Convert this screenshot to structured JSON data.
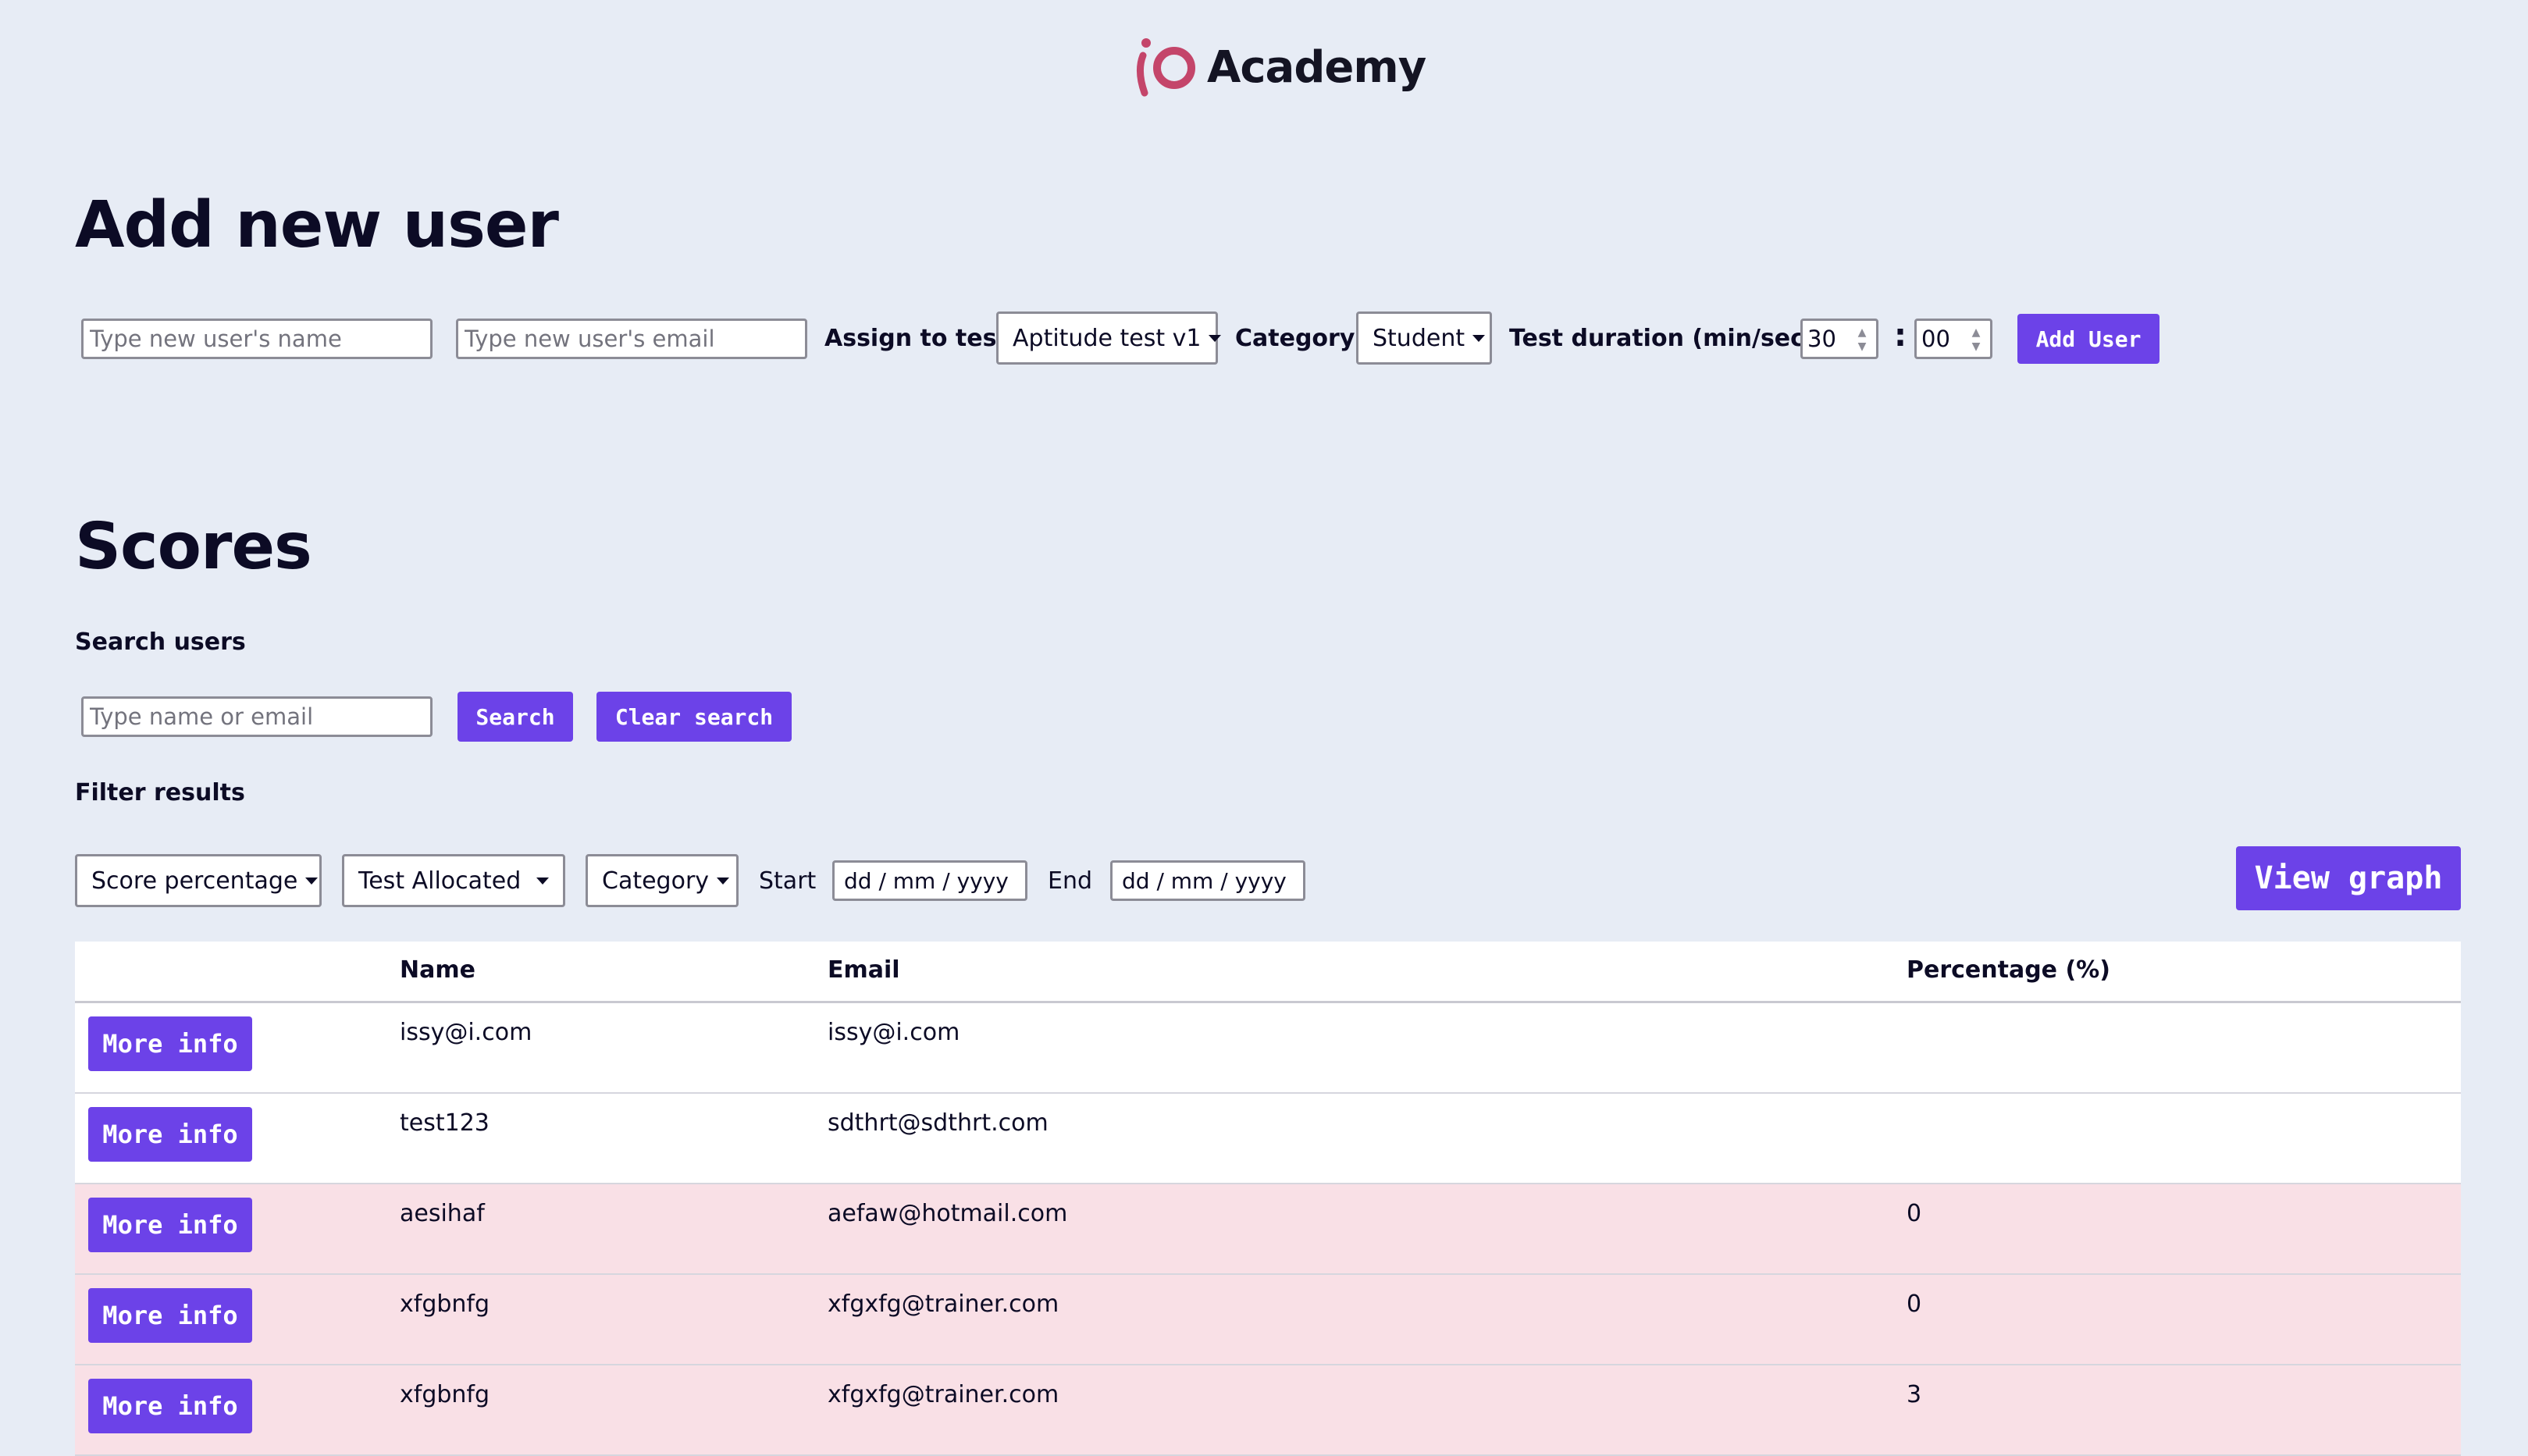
{
  "brand": {
    "name": "Academy",
    "logo_color": "#c4456a"
  },
  "add_user": {
    "title": "Add new user",
    "name_placeholder": "Type new user's name",
    "email_placeholder": "Type new user's email",
    "assign_label": "Assign to test:",
    "test_selected": "Aptitude test v1",
    "category_label": "Category:",
    "category_selected": "Student",
    "duration_label": "Test duration (min/sec) :",
    "minutes": "30",
    "seconds": "00",
    "colon": ":",
    "submit_label": "Add User"
  },
  "scores": {
    "title": "Scores",
    "search_label": "Search users",
    "search_placeholder": "Type name or email",
    "search_button": "Search",
    "clear_button": "Clear search",
    "filter_label": "Filter results",
    "filters": {
      "score": "Score percentage",
      "test": "Test Allocated",
      "category": "Category",
      "start_label": "Start",
      "start_value": "dd / mm / yyyy",
      "end_label": "End",
      "end_value": "dd / mm / yyyy"
    },
    "view_graph_button": "View graph",
    "table": {
      "columns": [
        "",
        "Name",
        "Email",
        "Percentage (%)"
      ],
      "row_button": "More info",
      "rows": [
        {
          "name": "issy@i.com",
          "email": "issy@i.com",
          "percentage": "",
          "flagged": false
        },
        {
          "name": "test123",
          "email": "sdthrt@sdthrt.com",
          "percentage": "",
          "flagged": false
        },
        {
          "name": "aesihaf",
          "email": "aefaw@hotmail.com",
          "percentage": "0",
          "flagged": true
        },
        {
          "name": "xfgbnfg",
          "email": "xfgxfg@trainer.com",
          "percentage": "0",
          "flagged": true
        },
        {
          "name": "xfgbnfg",
          "email": "xfgxfg@trainer.com",
          "percentage": "3",
          "flagged": true
        }
      ]
    }
  },
  "colors": {
    "background": "#e7ecf5",
    "accent": "#6c42e8",
    "flagged_row": "#f9e0e6",
    "text": "#0c0b25"
  }
}
